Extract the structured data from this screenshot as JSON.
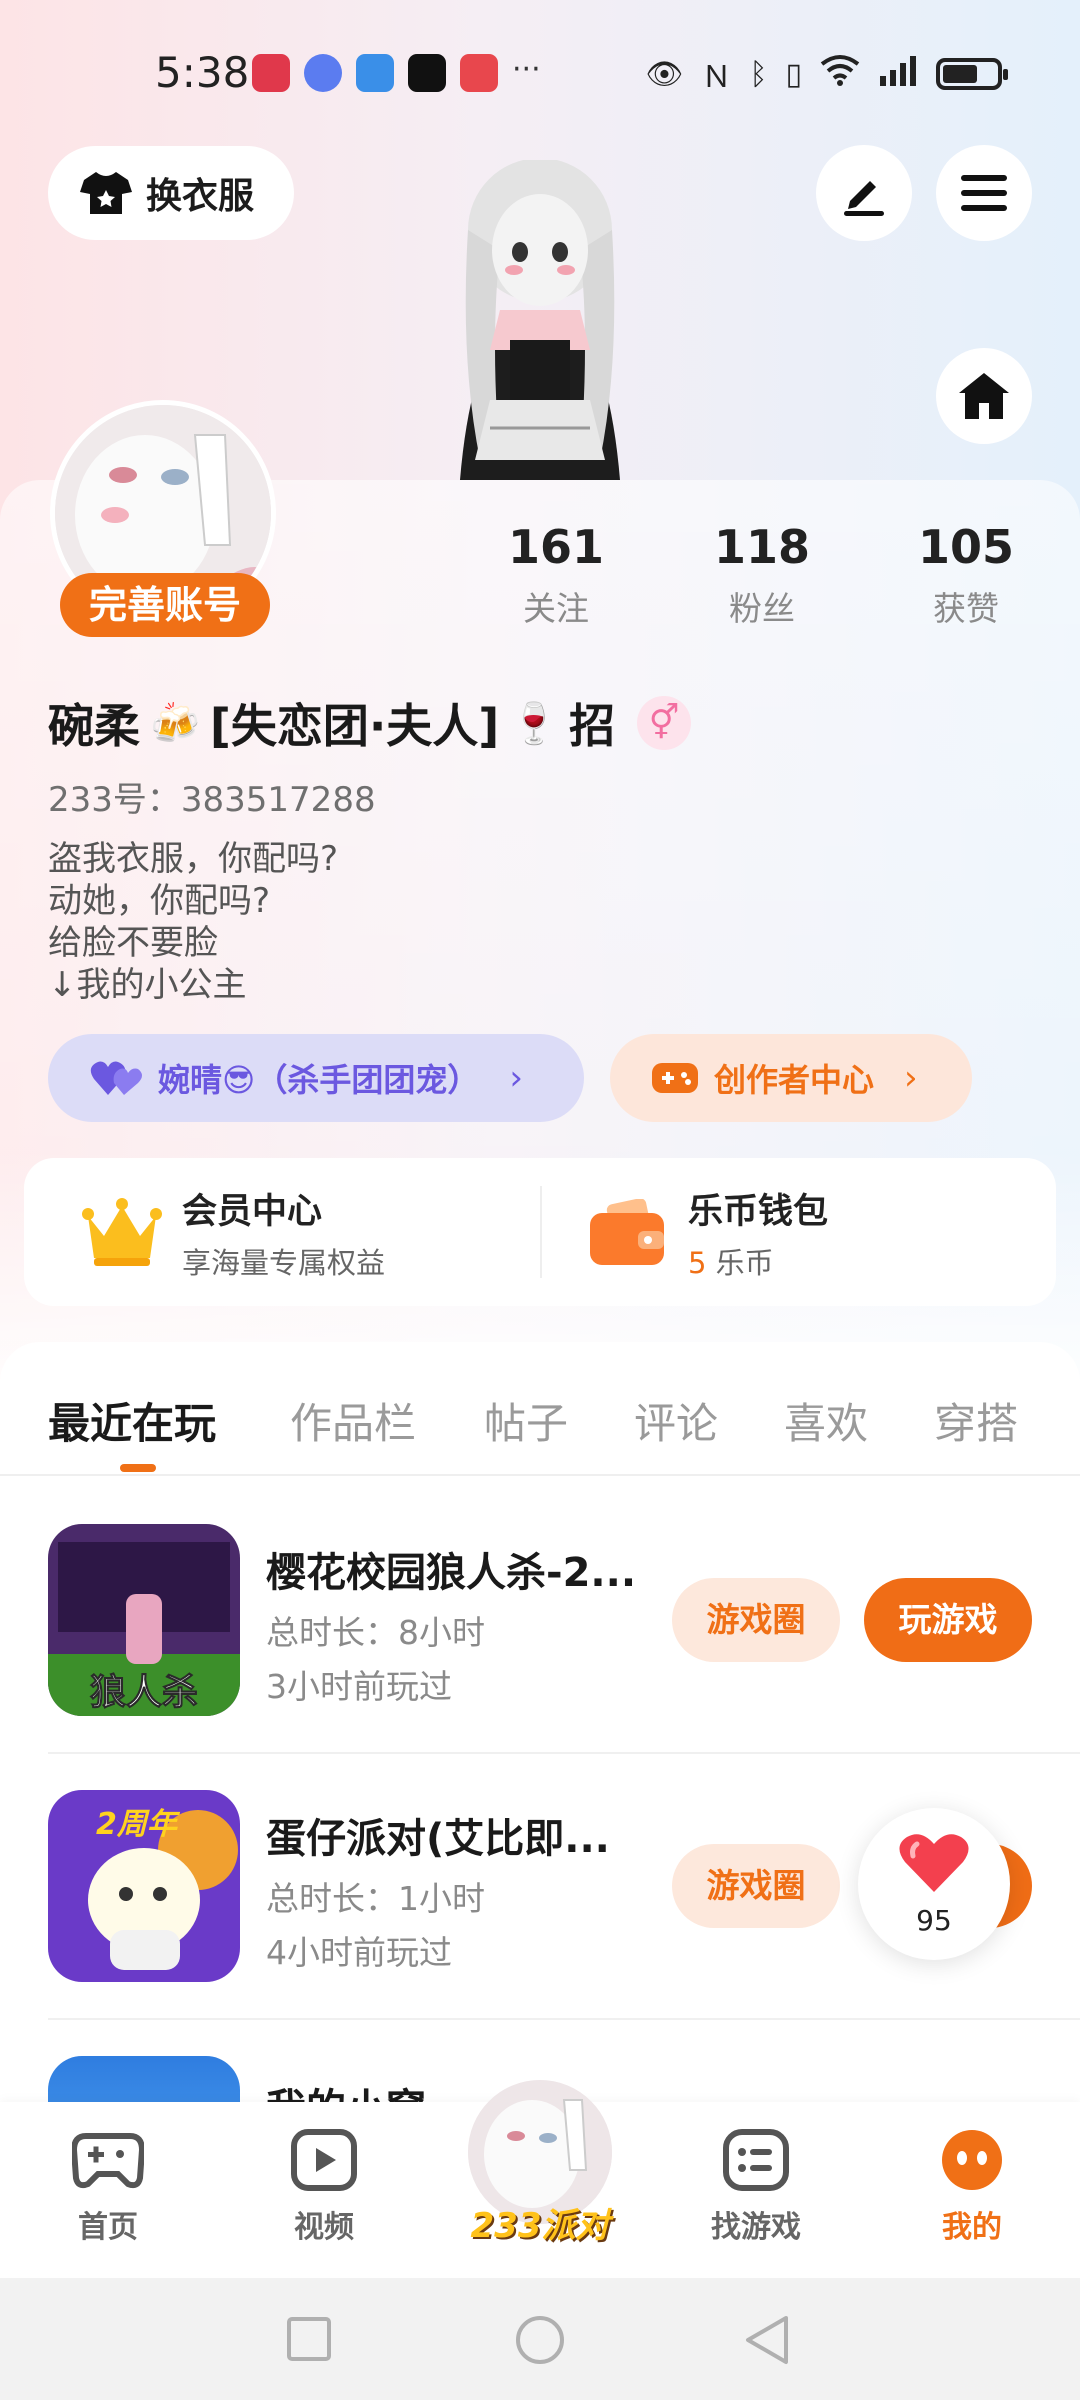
{
  "status_bar": {
    "time": "5:38",
    "more": "···"
  },
  "header": {
    "dress_label": "换衣服"
  },
  "profile": {
    "complete_label": "完善账号",
    "stats": [
      {
        "num": "161",
        "label": "关注"
      },
      {
        "num": "118",
        "label": "粉丝"
      },
      {
        "num": "105",
        "label": "获赞"
      }
    ],
    "nickname_a": "碗柔",
    "nickname_b": "[失恋团·夫人]",
    "nickname_c": "招",
    "gender_symbol": "⚥",
    "uid": "233号：383517288",
    "bio": [
      "盗我衣服，你配吗?",
      "动她，你配吗?",
      "给脸不要脸",
      "↓我的小公主"
    ],
    "relation_a": "婉晴",
    "relation_b": "（杀手团团宠）",
    "creator_label": "创作者中心"
  },
  "vip": {
    "title": "会员中心",
    "subtitle": "享海量专属权益",
    "wallet_title": "乐币钱包",
    "wallet_amount": "5",
    "wallet_unit": "乐币"
  },
  "tabs": [
    "最近在玩",
    "作品栏",
    "帖子",
    "评论",
    "喜欢",
    "穿搭"
  ],
  "games": [
    {
      "name": "樱花校园狼人杀-2...",
      "duration": "总时长：8小时",
      "last": "3小时前玩过",
      "circle": "游戏圈",
      "play": "玩游戏",
      "icon_text": "狼人杀"
    },
    {
      "name": "蛋仔派对(艾比即...",
      "duration": "总时长：1小时",
      "last": "4小时前玩过",
      "circle": "游戏圈",
      "play": "",
      "icon_text": "2周年"
    },
    {
      "name": "我的小窝"
    }
  ],
  "floating_like": {
    "count": "95"
  },
  "nav": {
    "home": "首页",
    "video": "视频",
    "center": "233派对",
    "find": "找游戏",
    "mine": "我的"
  },
  "colors": {
    "accent": "#f07016",
    "purple": "#6b58e0"
  }
}
